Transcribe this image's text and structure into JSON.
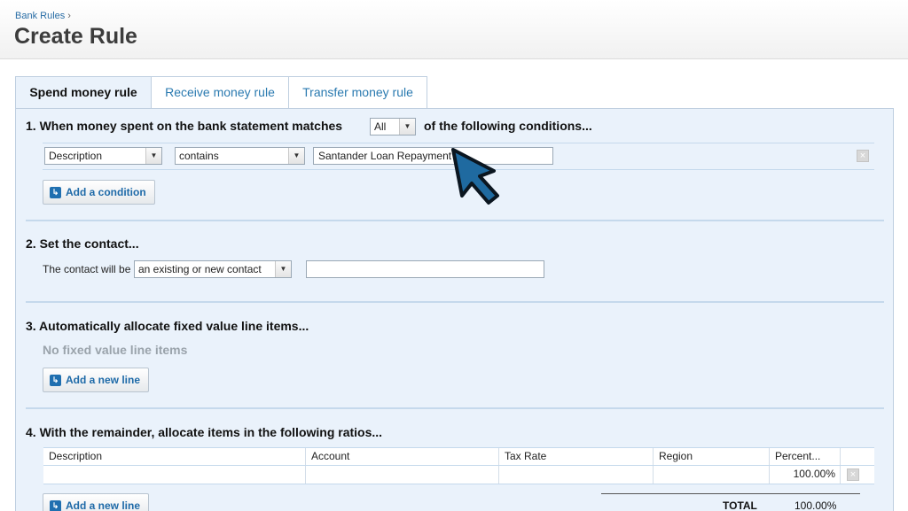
{
  "header": {
    "breadcrumb": "Bank Rules",
    "breadcrumb_sep": "›",
    "title": "Create Rule"
  },
  "tabs": [
    {
      "label": "Spend money rule",
      "active": true
    },
    {
      "label": "Receive money rule",
      "active": false
    },
    {
      "label": "Transfer money rule",
      "active": false
    }
  ],
  "section1": {
    "prefix": "1.  When money spent on the bank statement matches",
    "match_select": "All",
    "suffix": "of the following conditions...",
    "condition": {
      "field": "Description",
      "operator": "contains",
      "value": "Santander Loan Repayment"
    },
    "add_button": "Add a condition"
  },
  "section2": {
    "title": "2.  Set the contact...",
    "label": "The contact will be",
    "select": "an existing or new contact",
    "value": ""
  },
  "section3": {
    "title": "3.  Automatically allocate fixed value line items...",
    "empty_text": "No fixed value line items",
    "add_button": "Add a new line"
  },
  "section4": {
    "title": "4.  With the remainder, allocate items in the following ratios...",
    "columns": [
      "Description",
      "Account",
      "Tax Rate",
      "Region",
      "Percent..."
    ],
    "rows": [
      {
        "description": "",
        "account": "",
        "tax_rate": "",
        "region": "",
        "percent": "100.00%"
      }
    ],
    "add_button": "Add a new line",
    "total_label": "TOTAL",
    "total_value": "100.00%"
  },
  "icons": {
    "dropdown": "chevron-down-icon",
    "remove": "close-icon",
    "add": "add-icon",
    "cursor": "mouse-pointer-icon"
  },
  "colors": {
    "link": "#2a7ab0",
    "panel_bg": "#eaf2fb",
    "button_icon": "#1f6fb0",
    "cursor_fill": "#1f6aa0"
  }
}
